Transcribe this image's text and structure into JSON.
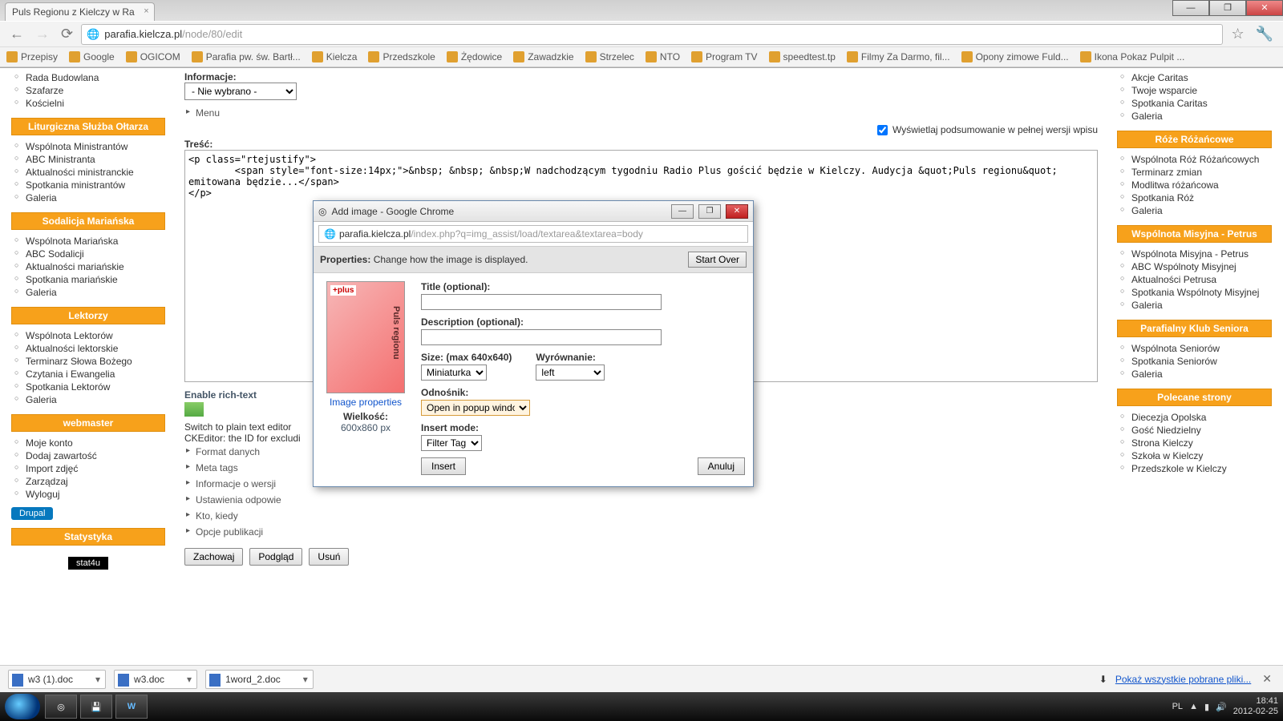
{
  "browser": {
    "tab_title": "Puls Regionu z Kielczy w Ra",
    "url_host": "parafia.kielcza.pl",
    "url_path": "/node/80/edit",
    "winbtn_min": "—",
    "winbtn_max": "❐",
    "winbtn_close": "✕"
  },
  "bookmarks": [
    "Przepisy",
    "Google",
    "OGICOM",
    "Parafia pw. św. Bartł...",
    "Kielcza",
    "Przedszkole",
    "Żędowice",
    "Zawadzkie",
    "Strzelec",
    "NTO",
    "Program TV",
    "speedtest.tp",
    "Filmy Za Darmo, fil...",
    "Opony zimowe Fuld...",
    "Ikona Pokaz Pulpit ..."
  ],
  "left_blocks": [
    {
      "title": null,
      "items": [
        "Rada Budowlana",
        "Szafarze",
        "Kościelni"
      ]
    },
    {
      "title": "Liturgiczna Służba Ołtarza",
      "items": [
        "Wspólnota Ministrantów",
        "ABC Ministranta",
        "Aktualności ministranckie",
        "Spotkania ministrantów",
        "Galeria"
      ]
    },
    {
      "title": "Sodalicja Mariańska",
      "items": [
        "Wspólnota Mariańska",
        "ABC Sodalicji",
        "Aktualności mariańskie",
        "Spotkania mariańskie",
        "Galeria"
      ]
    },
    {
      "title": "Lektorzy",
      "items": [
        "Wspólnota Lektorów",
        "Aktualności lektorskie",
        "Terminarz Słowa Bożego",
        "Czytania i Ewangelia",
        "Spotkania Lektorów",
        "Galeria"
      ]
    },
    {
      "title": "webmaster",
      "items": [
        "Moje konto",
        "Dodaj zawartość",
        "Import zdjęć",
        "Zarządzaj",
        "Wyloguj"
      ]
    },
    {
      "title": "Statystyka",
      "items": []
    }
  ],
  "right_blocks": [
    {
      "title": null,
      "items": [
        "Akcje Caritas",
        "Twoje wsparcie",
        "Spotkania Caritas",
        "Galeria"
      ]
    },
    {
      "title": "Róże Różańcowe",
      "items": [
        "Wspólnota Róż Różańcowych",
        "Terminarz zmian",
        "Modlitwa różańcowa",
        "Spotkania Róż",
        "Galeria"
      ]
    },
    {
      "title": "Wspólnota Misyjna - Petrus",
      "items": [
        "Wspólnota Misyjna - Petrus",
        "ABC Wspólnoty Misyjnej",
        "Aktualności Petrusa",
        "Spotkania Wspólnoty Misyjnej",
        "Galeria"
      ]
    },
    {
      "title": "Parafialny Klub Seniora",
      "items": [
        "Wspólnota Seniorów",
        "Spotkania Seniorów",
        "Galeria"
      ]
    },
    {
      "title": "Polecane strony",
      "items": [
        "Diecezja Opolska",
        "Gość Niedzielny",
        "Strona Kielczy",
        "Szkoła w Kielczy",
        "Przedszkole w Kielczy"
      ]
    }
  ],
  "drupal_badge": "Drupal",
  "stat_badge": "stat4u",
  "form": {
    "info_label": "Informacje:",
    "info_selected": "- Nie wybrano -",
    "menu_section": "Menu",
    "summary_toggle": "Wyświetlaj podsumowanie w pełnej wersji wpisu",
    "body_label": "Treść:",
    "body_content": "<p class=\"rtejustify\">\n        <span style=\"font-size:14px;\">&nbsp; &nbsp; &nbsp;W nadchodzącym tygodniu Radio Plus gościć będzie w Kielczy. Audycja &quot;Puls regionu&quot; emitowana będzie...</span>\n</p>",
    "enable_rich_text": "Enable rich-text",
    "plain_text_hint": "Switch to plain text editor",
    "ck_hint": "CKEditor: the ID for excludi",
    "collapsibles": [
      "Format danych",
      "Meta tags",
      "Informacje o wersji",
      "Ustawienia odpowie",
      "Kto, kiedy",
      "Opcje publikacji"
    ],
    "btn_save": "Zachowaj",
    "btn_preview": "Podgląd",
    "btn_delete": "Usuń"
  },
  "popup": {
    "window_title": "Add image - Google Chrome",
    "url_host": "parafia.kielcza.pl",
    "url_path": "/index.php?q=img_assist/load/textarea&textarea=body",
    "properties_label": "Properties:",
    "properties_desc": "Change how the image is displayed.",
    "start_over": "Start Over",
    "image_properties_link": "Image properties",
    "size_label_col": "Wielkość:",
    "size_value_col": "600x860 px",
    "title_label": "Title (optional):",
    "title_value": "",
    "desc_label": "Description (optional):",
    "desc_value": "",
    "size_label": "Size: (max 640x640)",
    "size_option": "Miniaturka",
    "align_label": "Wyrównanie:",
    "align_option": "left",
    "link_label": "Odnośnik:",
    "link_option": "Open in popup window",
    "insert_mode_label": "Insert mode:",
    "insert_mode_option": "Filter Tag",
    "btn_insert": "Insert",
    "btn_cancel": "Anuluj"
  },
  "downloads": {
    "items": [
      "w3 (1).doc",
      "w3.doc",
      "1word_2.doc"
    ],
    "show_all": "Pokaż wszystkie pobrane pliki..."
  },
  "taskbar": {
    "lang": "PL",
    "time": "18:41",
    "date": "2012-02-25"
  }
}
